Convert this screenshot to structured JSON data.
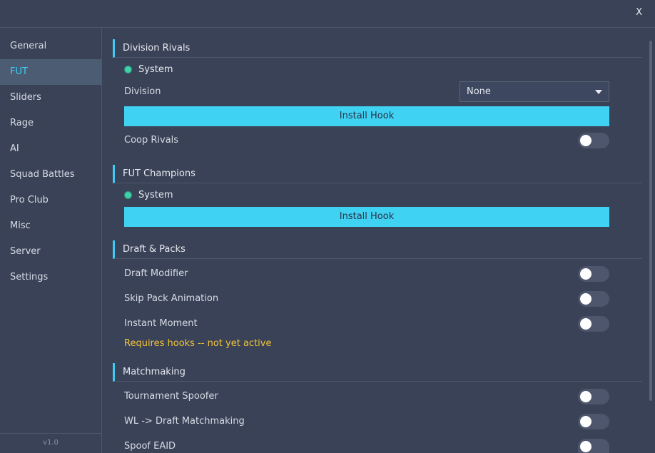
{
  "window": {
    "close_label": "X"
  },
  "sidebar": {
    "items": [
      {
        "label": "General"
      },
      {
        "label": "FUT"
      },
      {
        "label": "Sliders"
      },
      {
        "label": "Rage"
      },
      {
        "label": "AI"
      },
      {
        "label": "Squad Battles"
      },
      {
        "label": "Pro Club"
      },
      {
        "label": "Misc"
      },
      {
        "label": "Server"
      },
      {
        "label": "Settings"
      }
    ],
    "active": "FUT",
    "version": "v1.0"
  },
  "division_rivals": {
    "title": "Division Rivals",
    "system_label": "System",
    "division_label": "Division",
    "division_value": "None",
    "install_label": "Install Hook",
    "coop_label": "Coop Rivals",
    "coop_on": false
  },
  "fut_champions": {
    "title": "FUT Champions",
    "system_label": "System",
    "install_label": "Install Hook"
  },
  "draft_packs": {
    "title": "Draft & Packs",
    "draft_modifier_label": "Draft Modifier",
    "skip_pack_label": "Skip Pack Animation",
    "instant_moment_label": "Instant Moment",
    "warning": "Requires hooks -- not yet active"
  },
  "matchmaking": {
    "title": "Matchmaking",
    "tournament_spoofer_label": "Tournament Spoofer",
    "wl_draft_label": "WL -> Draft Matchmaking",
    "spoof_eaid_label": "Spoof EAID"
  },
  "colors": {
    "accent": "#3ecbf0",
    "background": "#3a4257",
    "button": "#3fd2f3",
    "warning": "#f3c43a",
    "radio": "#3fd1a8"
  }
}
